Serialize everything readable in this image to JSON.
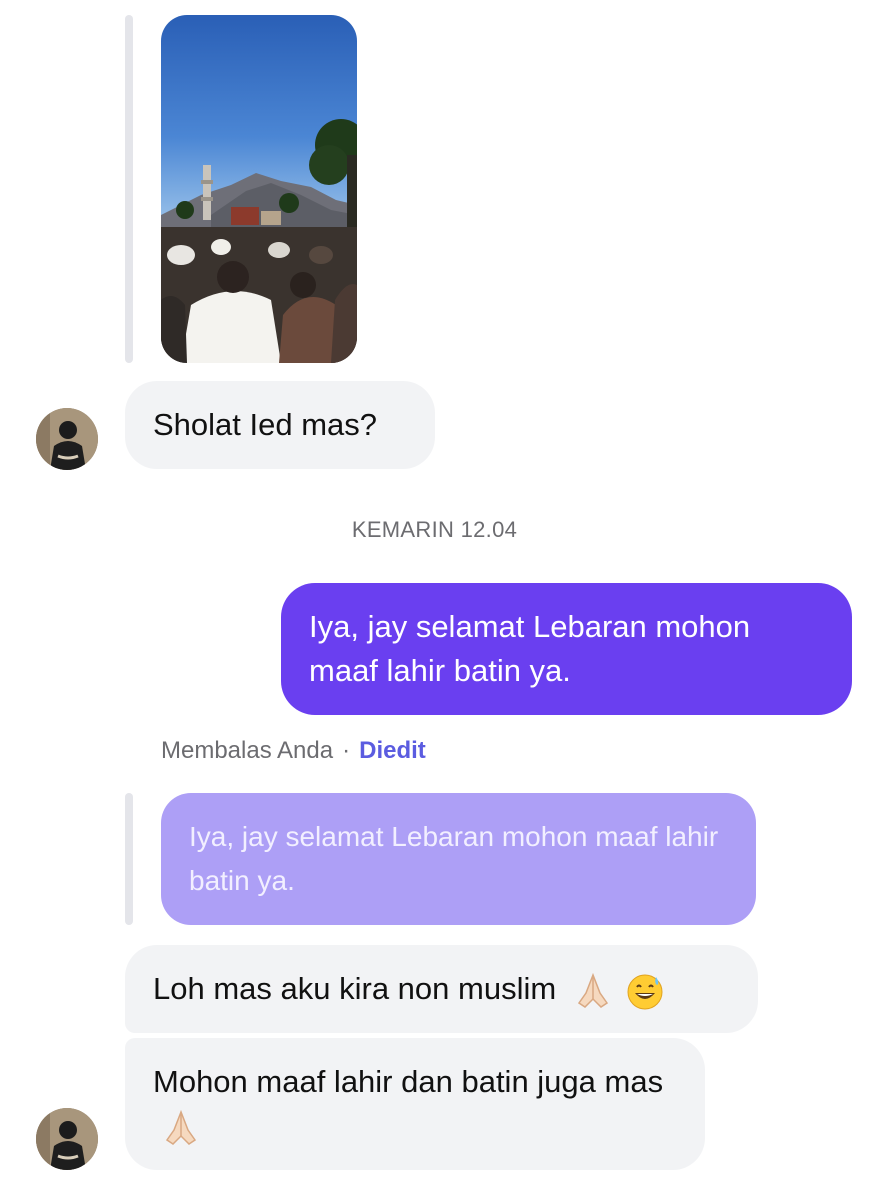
{
  "conversation": {
    "messages": {
      "photo_message": {
        "image_icon": "photo-prayer-crowd"
      },
      "question": {
        "text": "Sholat Ied mas?"
      },
      "timestamp": {
        "text": "KEMARIN 12.04"
      },
      "my_reply": {
        "text": "Iya, jay selamat Lebaran mohon maaf lahir batin ya."
      },
      "reply_meta": {
        "label": "Membalas Anda",
        "separator": "·",
        "edited": "Diedit"
      },
      "quoted_reply": {
        "text": "Iya, jay selamat Lebaran mohon maaf lahir batin ya."
      },
      "response_1": {
        "text": "Loh mas aku kira non muslim",
        "emojis": [
          "folded-hands-icon",
          "grinning-sweat-icon"
        ]
      },
      "response_2": {
        "text": "Mohon maaf lahir dan batin juga mas",
        "emojis": [
          "folded-hands-icon"
        ]
      }
    }
  },
  "colors": {
    "outgoing_bubble": "#6a3ff0",
    "incoming_bubble": "#f2f3f5",
    "quoted_bubble": "#ad9ff6",
    "edited_label": "#5b5ce0",
    "meta_text": "#6c6c70"
  }
}
